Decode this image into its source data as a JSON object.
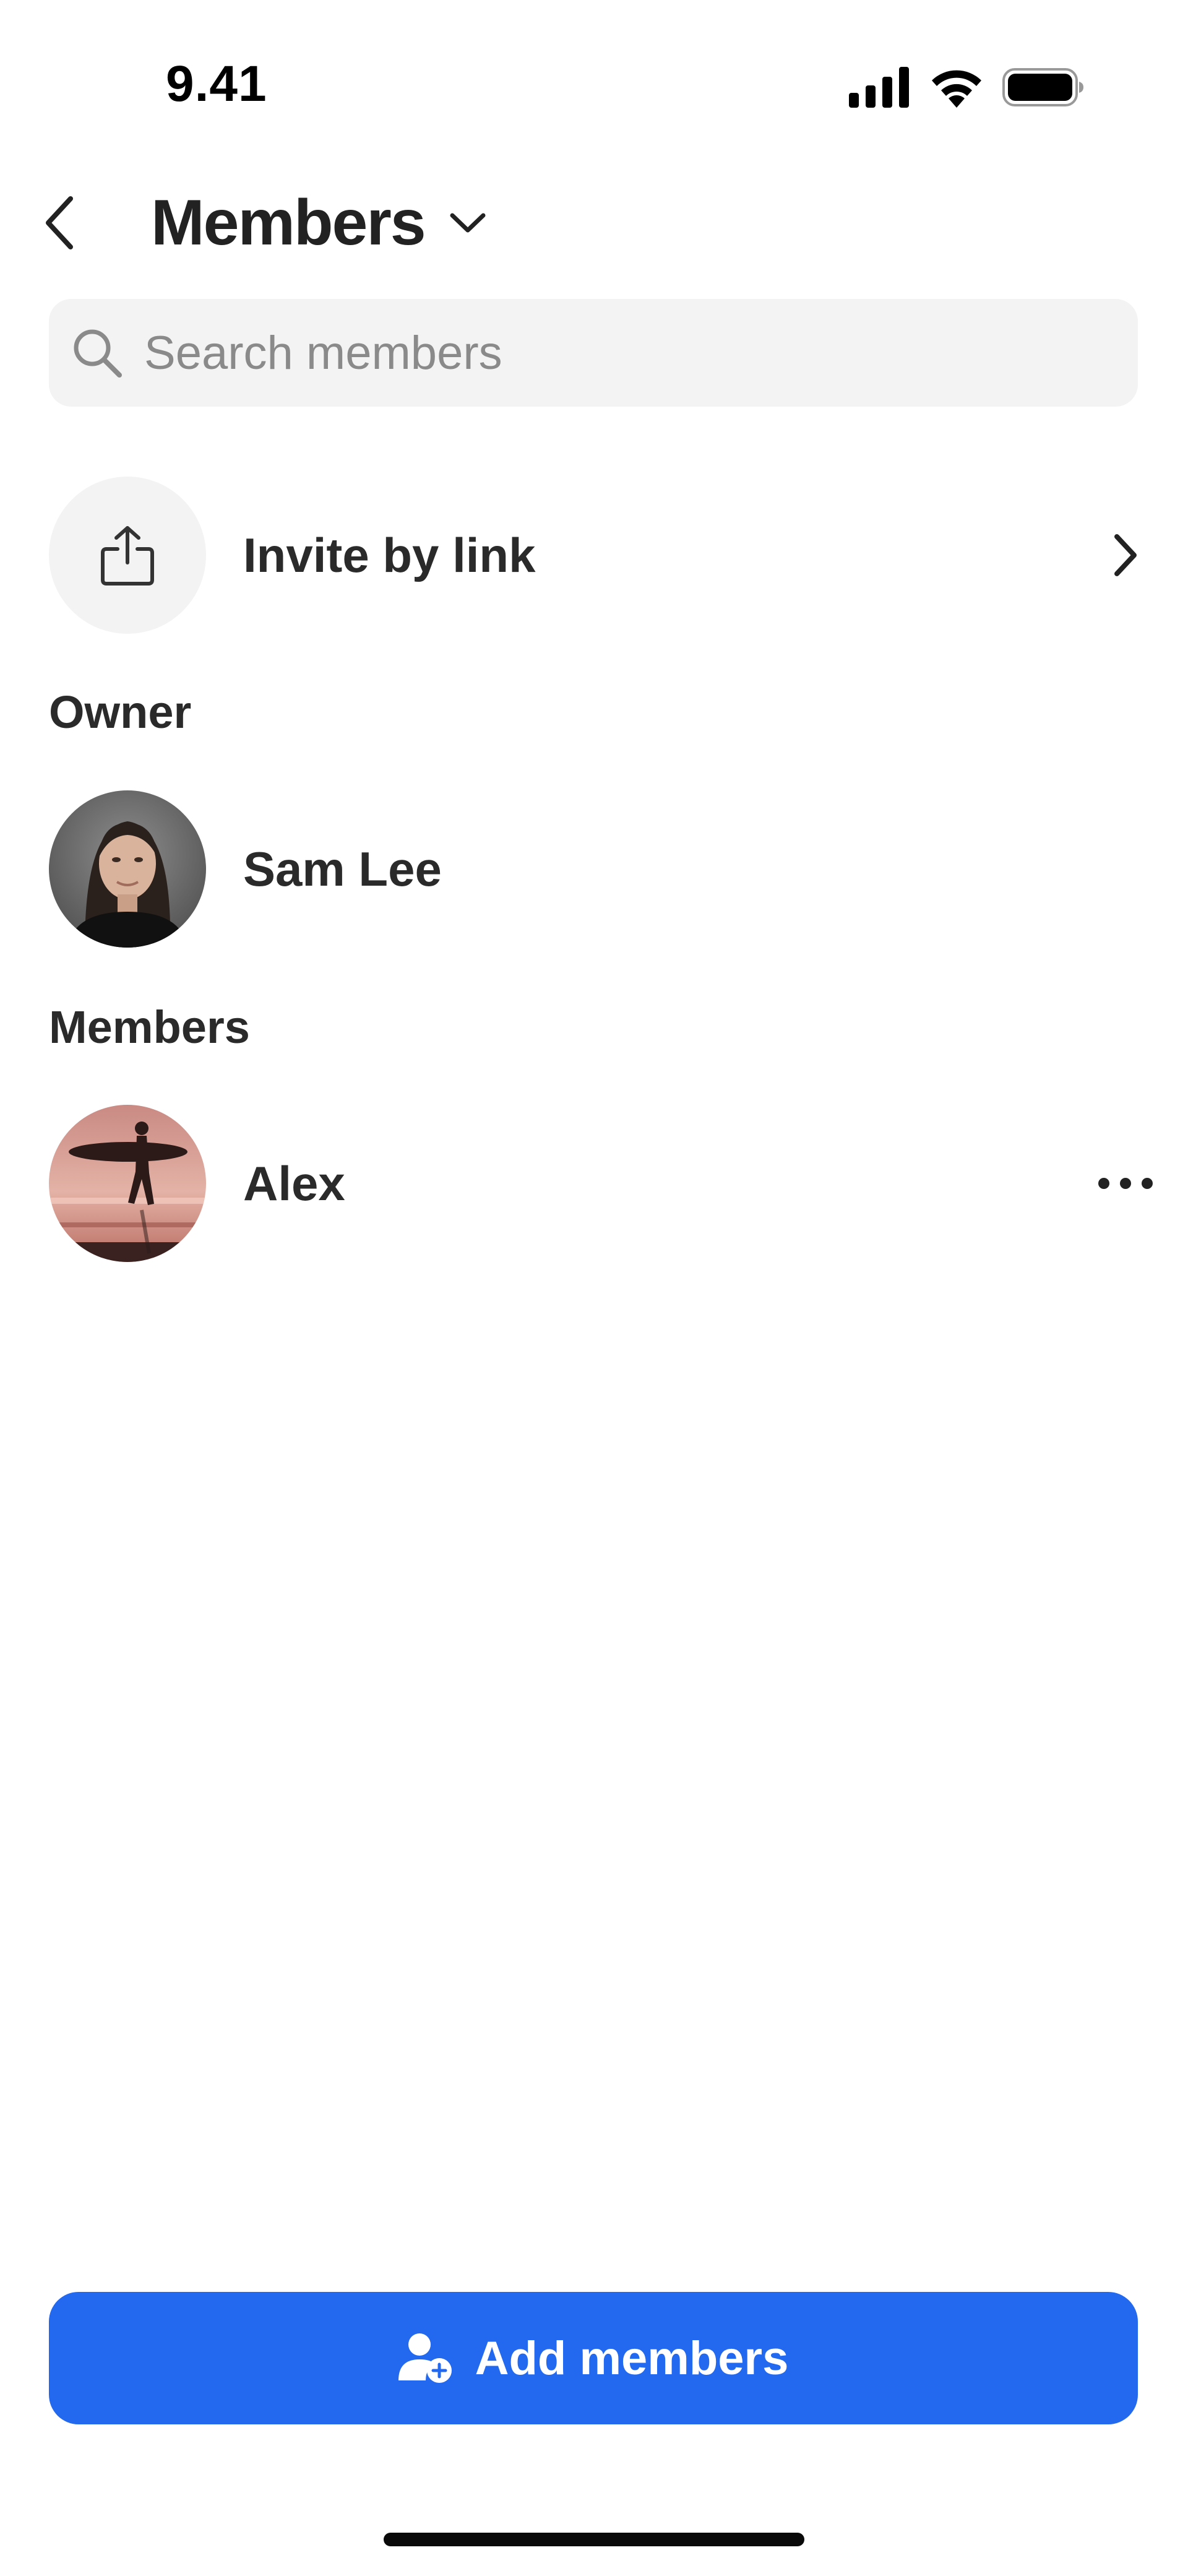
{
  "status_bar": {
    "time": "9.41"
  },
  "header": {
    "title": "Members",
    "back_icon": "chevron-left-icon",
    "dropdown_icon": "chevron-down-icon"
  },
  "search": {
    "placeholder": "Search members",
    "value": ""
  },
  "invite": {
    "label": "Invite by link",
    "icon": "share-icon"
  },
  "sections": {
    "owner_title": "Owner",
    "members_title": "Members"
  },
  "owner": {
    "name": "Sam Lee"
  },
  "members": [
    {
      "name": "Alex"
    }
  ],
  "add_button": {
    "label": "Add members",
    "icon": "add-person-icon"
  },
  "colors": {
    "accent": "#2369f0",
    "text": "#222222",
    "field_bg": "#f3f3f3"
  }
}
